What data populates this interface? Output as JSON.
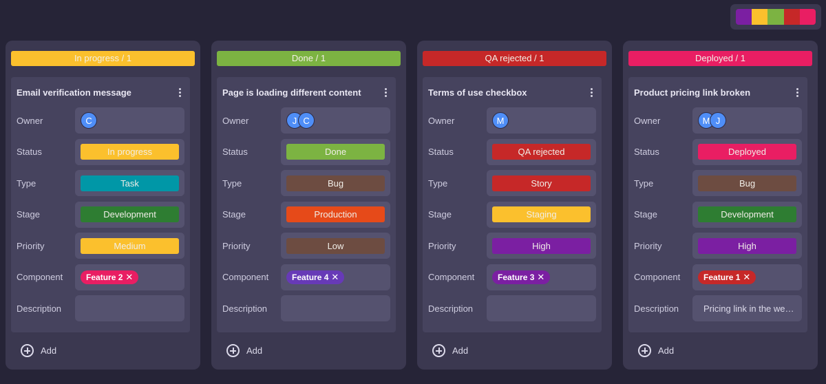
{
  "palette": [
    "#7b1fa2",
    "#fbc02d",
    "#7cb342",
    "#c62828",
    "#e91e63"
  ],
  "field_labels": {
    "owner": "Owner",
    "status": "Status",
    "type": "Type",
    "stage": "Stage",
    "priority": "Priority",
    "component": "Component",
    "description": "Description"
  },
  "add_label": "Add",
  "columns": [
    {
      "header": "In progress / 1",
      "color": "#fbc02d",
      "card": {
        "title": "Email verification message",
        "owners": [
          "C"
        ],
        "status": {
          "label": "In progress",
          "color": "#fbc02d"
        },
        "type": {
          "label": "Task",
          "color": "#0097a7"
        },
        "stage": {
          "label": "Development",
          "color": "#2e7d32"
        },
        "priority": {
          "label": "Medium",
          "color": "#fbc02d"
        },
        "component": {
          "label": "Feature 2",
          "color": "#e91e63"
        },
        "description": ""
      }
    },
    {
      "header": "Done / 1",
      "color": "#7cb342",
      "card": {
        "title": "Page is loading different content",
        "owners": [
          "J",
          "C"
        ],
        "status": {
          "label": "Done",
          "color": "#7cb342"
        },
        "type": {
          "label": "Bug",
          "color": "#6d4c41"
        },
        "stage": {
          "label": "Production",
          "color": "#e64a19"
        },
        "priority": {
          "label": "Low",
          "color": "#6d4c41"
        },
        "component": {
          "label": "Feature 4",
          "color": "#673ab7"
        },
        "description": ""
      }
    },
    {
      "header": "QA rejected / 1",
      "color": "#c62828",
      "card": {
        "title": "Terms of use checkbox",
        "owners": [
          "M"
        ],
        "status": {
          "label": "QA rejected",
          "color": "#c62828"
        },
        "type": {
          "label": "Story",
          "color": "#c62828"
        },
        "stage": {
          "label": "Staging",
          "color": "#fbc02d"
        },
        "priority": {
          "label": "High",
          "color": "#7b1fa2"
        },
        "component": {
          "label": "Feature 3",
          "color": "#7b1fa2"
        },
        "description": ""
      }
    },
    {
      "header": "Deployed / 1",
      "color": "#e91e63",
      "card": {
        "title": "Product pricing link broken",
        "owners": [
          "M",
          "J"
        ],
        "status": {
          "label": "Deployed",
          "color": "#e91e63"
        },
        "type": {
          "label": "Bug",
          "color": "#6d4c41"
        },
        "stage": {
          "label": "Development",
          "color": "#2e7d32"
        },
        "priority": {
          "label": "High",
          "color": "#7b1fa2"
        },
        "component": {
          "label": "Feature 1",
          "color": "#c62828"
        },
        "description": "Pricing link in the we…"
      }
    }
  ]
}
